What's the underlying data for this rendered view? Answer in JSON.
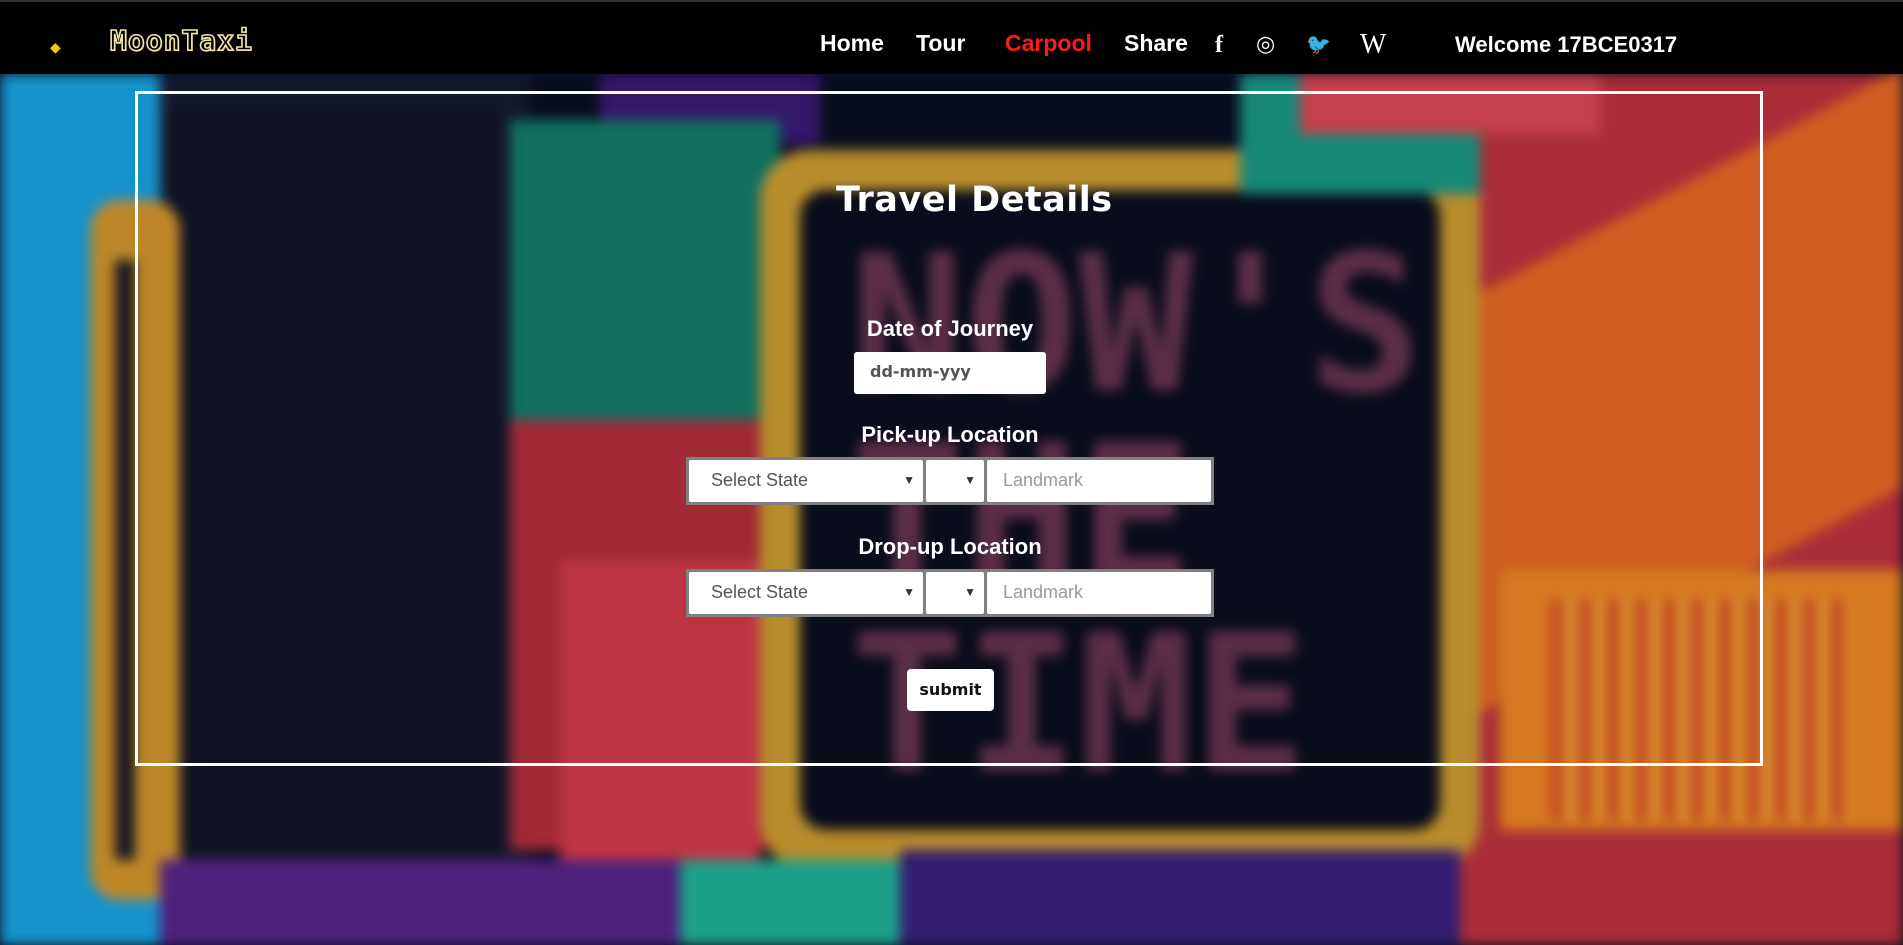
{
  "header": {
    "brand": "MoonTaxi",
    "logo_icon": "taxi-logo-icon",
    "nav": [
      {
        "label": "Home"
      },
      {
        "label": "Tour"
      },
      {
        "label": "Carpool",
        "active": true
      },
      {
        "label": "Share"
      }
    ],
    "social": [
      {
        "icon": "facebook-icon",
        "glyph": "f"
      },
      {
        "icon": "instagram-icon",
        "glyph": "◎"
      },
      {
        "icon": "twitter-icon",
        "glyph": "🐦"
      },
      {
        "icon": "wikipedia-icon",
        "glyph": "W"
      }
    ],
    "welcome": "Welcome 17BCE0317",
    "active_color": "#ff1a1a"
  },
  "form": {
    "title": "Travel Details",
    "date_label": "Date of Journey",
    "date_placeholder": "dd-mm-yyy",
    "pickup_label": "Pick-up Location",
    "dropoff_label": "Drop-up Location",
    "state_placeholder": "Select State",
    "city_value": "",
    "landmark_placeholder": "Landmark",
    "submit_label": "submit"
  },
  "background_text": "NOW'S THE TIME"
}
